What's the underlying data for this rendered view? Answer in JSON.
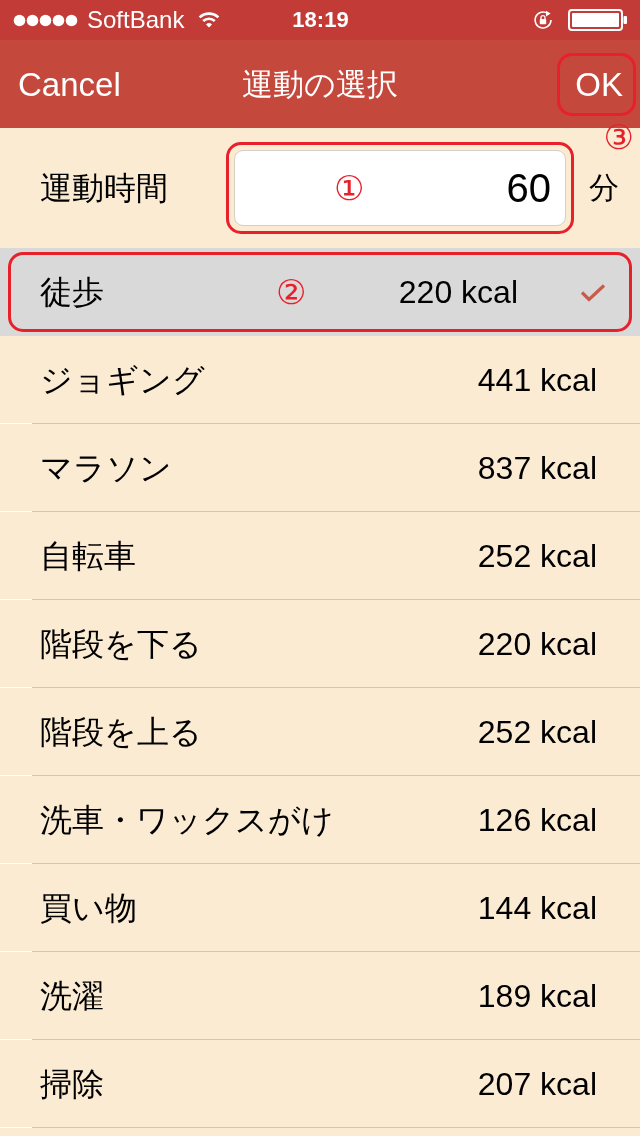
{
  "status_bar": {
    "carrier": "SoftBank",
    "time": "18:19"
  },
  "nav_bar": {
    "cancel": "Cancel",
    "title": "運動の選択",
    "ok": "OK"
  },
  "duration": {
    "label": "運動時間",
    "value": "60",
    "unit": "分"
  },
  "exercises": [
    {
      "name": "徒歩",
      "kcal": "220 kcal",
      "selected": true
    },
    {
      "name": "ジョギング",
      "kcal": "441 kcal",
      "selected": false
    },
    {
      "name": "マラソン",
      "kcal": "837 kcal",
      "selected": false
    },
    {
      "name": "自転車",
      "kcal": "252 kcal",
      "selected": false
    },
    {
      "name": "階段を下る",
      "kcal": "220 kcal",
      "selected": false
    },
    {
      "name": "階段を上る",
      "kcal": "252 kcal",
      "selected": false
    },
    {
      "name": "洗車・ワックスがけ",
      "kcal": "126 kcal",
      "selected": false
    },
    {
      "name": "買い物",
      "kcal": "144 kcal",
      "selected": false
    },
    {
      "name": "洗濯",
      "kcal": "189 kcal",
      "selected": false
    },
    {
      "name": "掃除",
      "kcal": "207 kcal",
      "selected": false
    }
  ],
  "annotations": [
    {
      "kind": "field",
      "label": "①"
    },
    {
      "kind": "selected_row",
      "label": "②"
    },
    {
      "kind": "ok_button",
      "label": "③"
    }
  ]
}
